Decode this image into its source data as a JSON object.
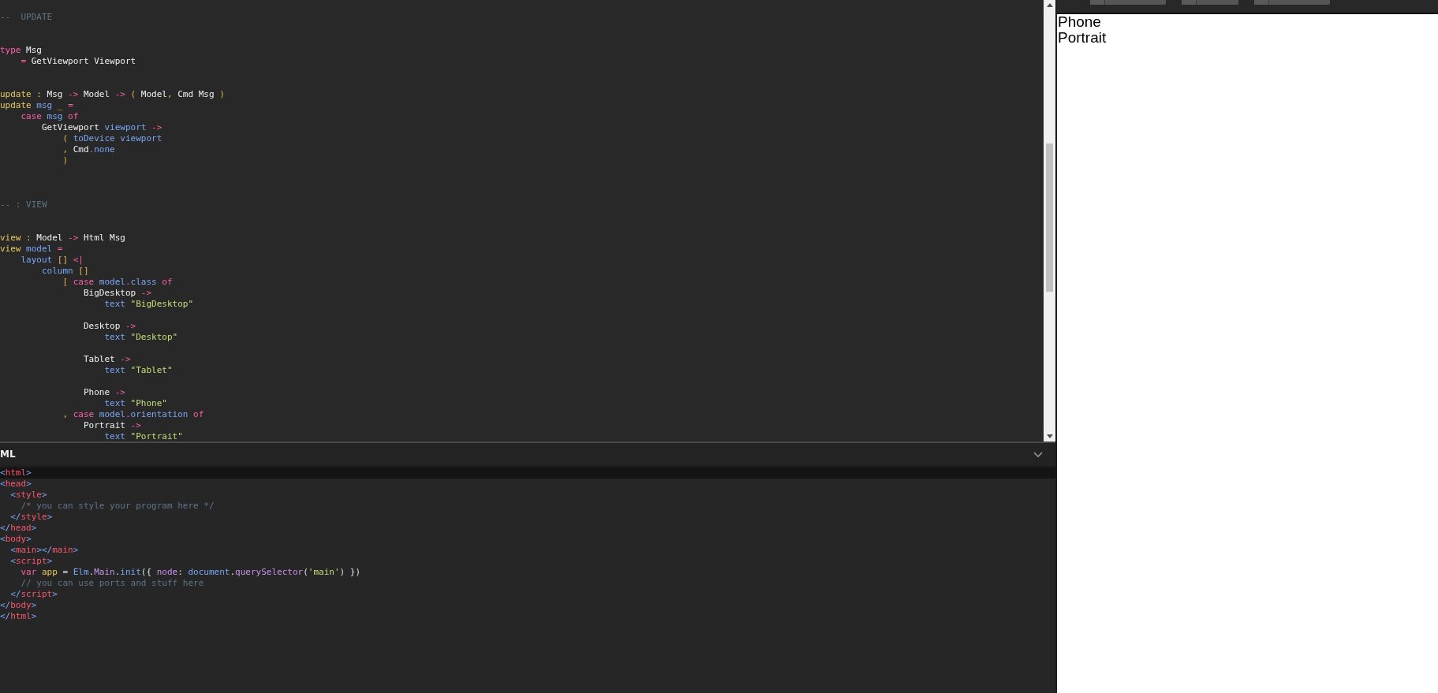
{
  "editor": {
    "lines": [
      {
        "kind": "code",
        "tokens": [
          {
            "text": "--  UPDATE",
            "kind": "c"
          }
        ]
      },
      {
        "kind": "blank"
      },
      {
        "kind": "blank"
      },
      {
        "kind": "code",
        "tokens": [
          {
            "text": "type",
            "kind": "kw"
          },
          {
            "text": " Msg",
            "kind": "ty"
          }
        ]
      },
      {
        "kind": "code",
        "tokens": [
          {
            "text": "    =",
            "kind": "op"
          },
          {
            "text": " GetViewport Viewport",
            "kind": "ty"
          }
        ]
      },
      {
        "kind": "blank"
      },
      {
        "kind": "blank"
      },
      {
        "kind": "code",
        "tokens": [
          {
            "text": "update :",
            "kind": "fn"
          },
          {
            "text": " Msg ",
            "kind": "ty"
          },
          {
            "text": "->",
            "kind": "op"
          },
          {
            "text": " Model ",
            "kind": "ty"
          },
          {
            "text": "->",
            "kind": "op"
          },
          {
            "text": " (",
            "kind": "p"
          },
          {
            "text": " Model",
            "kind": "ty"
          },
          {
            "text": ",",
            "kind": "p"
          },
          {
            "text": " Cmd Msg ",
            "kind": "ty"
          },
          {
            "text": ")",
            "kind": "p"
          }
        ]
      },
      {
        "kind": "code",
        "tokens": [
          {
            "text": "update",
            "kind": "fn"
          },
          {
            "text": " msg",
            "kind": "v"
          },
          {
            "text": " _ ",
            "kind": "fn"
          },
          {
            "text": "=",
            "kind": "op"
          }
        ]
      },
      {
        "kind": "code",
        "tokens": [
          {
            "text": "    case",
            "kind": "kw"
          },
          {
            "text": " msg",
            "kind": "v"
          },
          {
            "text": " of",
            "kind": "kw"
          }
        ]
      },
      {
        "kind": "code",
        "tokens": [
          {
            "text": "        GetViewport",
            "kind": "ty"
          },
          {
            "text": " viewport",
            "kind": "v"
          },
          {
            "text": " ->",
            "kind": "op"
          }
        ]
      },
      {
        "kind": "code",
        "tokens": [
          {
            "text": "            (",
            "kind": "p"
          },
          {
            "text": " toDevice viewport",
            "kind": "v"
          }
        ]
      },
      {
        "kind": "code",
        "tokens": [
          {
            "text": "            ,",
            "kind": "p"
          },
          {
            "text": " Cmd",
            "kind": "ty"
          },
          {
            "text": ".",
            "kind": "op"
          },
          {
            "text": "none",
            "kind": "v"
          }
        ]
      },
      {
        "kind": "code",
        "tokens": [
          {
            "text": "            )",
            "kind": "p"
          }
        ]
      },
      {
        "kind": "blank"
      },
      {
        "kind": "blank"
      },
      {
        "kind": "blank"
      },
      {
        "kind": "code",
        "tokens": [
          {
            "text": "-- : VIEW",
            "kind": "c"
          }
        ]
      },
      {
        "kind": "blank"
      },
      {
        "kind": "blank"
      },
      {
        "kind": "code",
        "tokens": [
          {
            "text": "view :",
            "kind": "fn"
          },
          {
            "text": " Model ",
            "kind": "ty"
          },
          {
            "text": "->",
            "kind": "op"
          },
          {
            "text": " Html Msg",
            "kind": "ty"
          }
        ]
      },
      {
        "kind": "code",
        "tokens": [
          {
            "text": "view",
            "kind": "fn"
          },
          {
            "text": " model",
            "kind": "v"
          },
          {
            "text": " =",
            "kind": "op"
          }
        ]
      },
      {
        "kind": "code",
        "tokens": [
          {
            "text": "    layout",
            "kind": "v"
          },
          {
            "text": " []",
            "kind": "p"
          },
          {
            "text": " <|",
            "kind": "op"
          }
        ]
      },
      {
        "kind": "code",
        "tokens": [
          {
            "text": "        column",
            "kind": "v"
          },
          {
            "text": " []",
            "kind": "p"
          }
        ]
      },
      {
        "kind": "code",
        "tokens": [
          {
            "text": "            [",
            "kind": "p"
          },
          {
            "text": " case",
            "kind": "kw"
          },
          {
            "text": " model",
            "kind": "v"
          },
          {
            "text": ".",
            "kind": "op"
          },
          {
            "text": "class",
            "kind": "v"
          },
          {
            "text": " of",
            "kind": "kw"
          }
        ]
      },
      {
        "kind": "code",
        "tokens": [
          {
            "text": "                BigDesktop",
            "kind": "ty"
          },
          {
            "text": " ->",
            "kind": "op"
          }
        ]
      },
      {
        "kind": "code",
        "tokens": [
          {
            "text": "                    text",
            "kind": "v"
          },
          {
            "text": " \"BigDesktop\"",
            "kind": "s"
          }
        ]
      },
      {
        "kind": "blank"
      },
      {
        "kind": "code",
        "tokens": [
          {
            "text": "                Desktop",
            "kind": "ty"
          },
          {
            "text": " ->",
            "kind": "op"
          }
        ]
      },
      {
        "kind": "code",
        "tokens": [
          {
            "text": "                    text",
            "kind": "v"
          },
          {
            "text": " \"Desktop\"",
            "kind": "s"
          }
        ]
      },
      {
        "kind": "blank"
      },
      {
        "kind": "code",
        "tokens": [
          {
            "text": "                Tablet",
            "kind": "ty"
          },
          {
            "text": " ->",
            "kind": "op"
          }
        ]
      },
      {
        "kind": "code",
        "tokens": [
          {
            "text": "                    text",
            "kind": "v"
          },
          {
            "text": " \"Tablet\"",
            "kind": "s"
          }
        ]
      },
      {
        "kind": "blank"
      },
      {
        "kind": "code",
        "tokens": [
          {
            "text": "                Phone",
            "kind": "ty"
          },
          {
            "text": " ->",
            "kind": "op"
          }
        ]
      },
      {
        "kind": "code",
        "tokens": [
          {
            "text": "                    text",
            "kind": "v"
          },
          {
            "text": " \"Phone\"",
            "kind": "s"
          }
        ]
      },
      {
        "kind": "code",
        "tokens": [
          {
            "text": "            ,",
            "kind": "p"
          },
          {
            "text": " case",
            "kind": "kw"
          },
          {
            "text": " model",
            "kind": "v"
          },
          {
            "text": ".",
            "kind": "op"
          },
          {
            "text": "orientation",
            "kind": "v"
          },
          {
            "text": " of",
            "kind": "kw"
          }
        ]
      },
      {
        "kind": "code",
        "tokens": [
          {
            "text": "                Portrait",
            "kind": "ty"
          },
          {
            "text": " ->",
            "kind": "op"
          }
        ]
      },
      {
        "kind": "code",
        "tokens": [
          {
            "text": "                    text",
            "kind": "v"
          },
          {
            "text": " \"Portrait\"",
            "kind": "s"
          }
        ]
      }
    ]
  },
  "html_panel": {
    "title": "ML",
    "lines": [
      {
        "current": true,
        "tokens": [
          {
            "text": "<",
            "kind": "b"
          },
          {
            "text": "html",
            "kind": "t"
          },
          {
            "text": ">",
            "kind": "b"
          }
        ]
      },
      {
        "current": false,
        "tokens": [
          {
            "text": "<",
            "kind": "b"
          },
          {
            "text": "head",
            "kind": "t"
          },
          {
            "text": ">",
            "kind": "b"
          }
        ]
      },
      {
        "current": false,
        "tokens": [
          {
            "text": "  <",
            "kind": "b"
          },
          {
            "text": "style",
            "kind": "t"
          },
          {
            "text": ">",
            "kind": "b"
          }
        ]
      },
      {
        "current": false,
        "tokens": [
          {
            "text": "    /* you can style your program here */",
            "kind": "c"
          }
        ]
      },
      {
        "current": false,
        "tokens": [
          {
            "text": "  </",
            "kind": "b"
          },
          {
            "text": "style",
            "kind": "t"
          },
          {
            "text": ">",
            "kind": "b"
          }
        ]
      },
      {
        "current": false,
        "tokens": [
          {
            "text": "</",
            "kind": "b"
          },
          {
            "text": "head",
            "kind": "t"
          },
          {
            "text": ">",
            "kind": "b"
          }
        ]
      },
      {
        "current": false,
        "tokens": [
          {
            "text": "<",
            "kind": "b"
          },
          {
            "text": "body",
            "kind": "t"
          },
          {
            "text": ">",
            "kind": "b"
          }
        ]
      },
      {
        "current": false,
        "tokens": [
          {
            "text": "  <",
            "kind": "b"
          },
          {
            "text": "main",
            "kind": "t"
          },
          {
            "text": "></",
            "kind": "b"
          },
          {
            "text": "main",
            "kind": "t"
          },
          {
            "text": ">",
            "kind": "b"
          }
        ]
      },
      {
        "current": false,
        "tokens": [
          {
            "text": "  <",
            "kind": "b"
          },
          {
            "text": "script",
            "kind": "t"
          },
          {
            "text": ">",
            "kind": "b"
          }
        ]
      },
      {
        "current": false,
        "tokens": [
          {
            "text": "    var",
            "kind": "kw"
          },
          {
            "text": " app",
            "kind": "fn"
          },
          {
            "text": " = ",
            "kind": "w"
          },
          {
            "text": "Elm",
            "kind": "v"
          },
          {
            "text": ".",
            "kind": "w"
          },
          {
            "text": "Main",
            "kind": "m"
          },
          {
            "text": ".",
            "kind": "w"
          },
          {
            "text": "init",
            "kind": "v"
          },
          {
            "text": "({ ",
            "kind": "w"
          },
          {
            "text": "node",
            "kind": "m"
          },
          {
            "text": ": ",
            "kind": "w"
          },
          {
            "text": "document",
            "kind": "v"
          },
          {
            "text": ".",
            "kind": "w"
          },
          {
            "text": "querySelector",
            "kind": "m"
          },
          {
            "text": "(",
            "kind": "w"
          },
          {
            "text": "'main'",
            "kind": "s"
          },
          {
            "text": ") })",
            "kind": "w"
          }
        ]
      },
      {
        "current": false,
        "tokens": [
          {
            "text": "    // you can use ports and stuff here",
            "kind": "c"
          }
        ]
      },
      {
        "current": false,
        "tokens": [
          {
            "text": "  </",
            "kind": "b"
          },
          {
            "text": "script",
            "kind": "t"
          },
          {
            "text": ">",
            "kind": "b"
          }
        ]
      },
      {
        "current": false,
        "tokens": [
          {
            "text": "</",
            "kind": "b"
          },
          {
            "text": "body",
            "kind": "t"
          },
          {
            "text": ">",
            "kind": "b"
          }
        ]
      },
      {
        "current": false,
        "tokens": [
          {
            "text": "</",
            "kind": "b"
          },
          {
            "text": "html",
            "kind": "t"
          },
          {
            "text": ">",
            "kind": "b"
          }
        ]
      }
    ]
  },
  "output": {
    "lines": [
      "Phone",
      "Portrait"
    ]
  }
}
